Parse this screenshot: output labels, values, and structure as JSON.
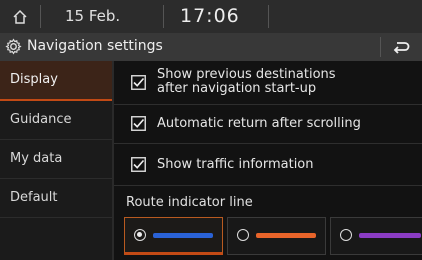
{
  "status": {
    "date": "15 Feb.",
    "time": "17:06"
  },
  "header": {
    "title": "Navigation settings",
    "icon": "gear-icon",
    "back_icon": "back-arrow-icon"
  },
  "menu": [
    {
      "label": "Display",
      "active": true
    },
    {
      "label": "Guidance",
      "active": false
    },
    {
      "label": "My data",
      "active": false
    },
    {
      "label": "Default",
      "active": false
    }
  ],
  "options": [
    {
      "line1": "Show previous destinations",
      "line2": "after navigation start-up",
      "checked": true
    },
    {
      "line1": "Automatic return after scrolling",
      "checked": true
    },
    {
      "line1": "Show traffic information",
      "checked": true
    }
  ],
  "route_indicator": {
    "label": "Route indicator line",
    "choices": [
      {
        "color": "#2a62d6",
        "selected": true
      },
      {
        "color": "#e8642a",
        "selected": false
      },
      {
        "color": "#8b3cc4",
        "selected": false
      }
    ]
  },
  "colors": {
    "accent": "#c24a15",
    "background": "#121212"
  }
}
